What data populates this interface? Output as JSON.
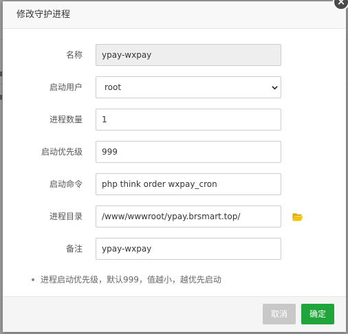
{
  "dialog": {
    "title": "修改守护进程",
    "close_label": "×"
  },
  "form": {
    "name": {
      "label": "名称",
      "value": "ypay-wxpay"
    },
    "user": {
      "label": "启动用户",
      "value": "root"
    },
    "num_procs": {
      "label": "进程数量",
      "value": "1"
    },
    "priority": {
      "label": "启动优先级",
      "value": "999"
    },
    "command": {
      "label": "启动命令",
      "value": "php think order wxpay_cron"
    },
    "directory": {
      "label": "进程目录",
      "value": "/www/wwwroot/ypay.brsmart.top/"
    },
    "remark": {
      "label": "备注",
      "value": "ypay-wxpay"
    }
  },
  "tips": [
    "进程启动优先级，默认999，值越小，越优先启动"
  ],
  "footer": {
    "cancel_label": "取消",
    "confirm_label": "确定"
  },
  "colors": {
    "confirm_button": "#20a53a",
    "cancel_button": "#c8c8c8",
    "folder_icon": "#f0b400"
  },
  "icons": {
    "folder": "folder-open-icon",
    "close": "close-icon",
    "select_arrow": "chevron-down-icon"
  }
}
